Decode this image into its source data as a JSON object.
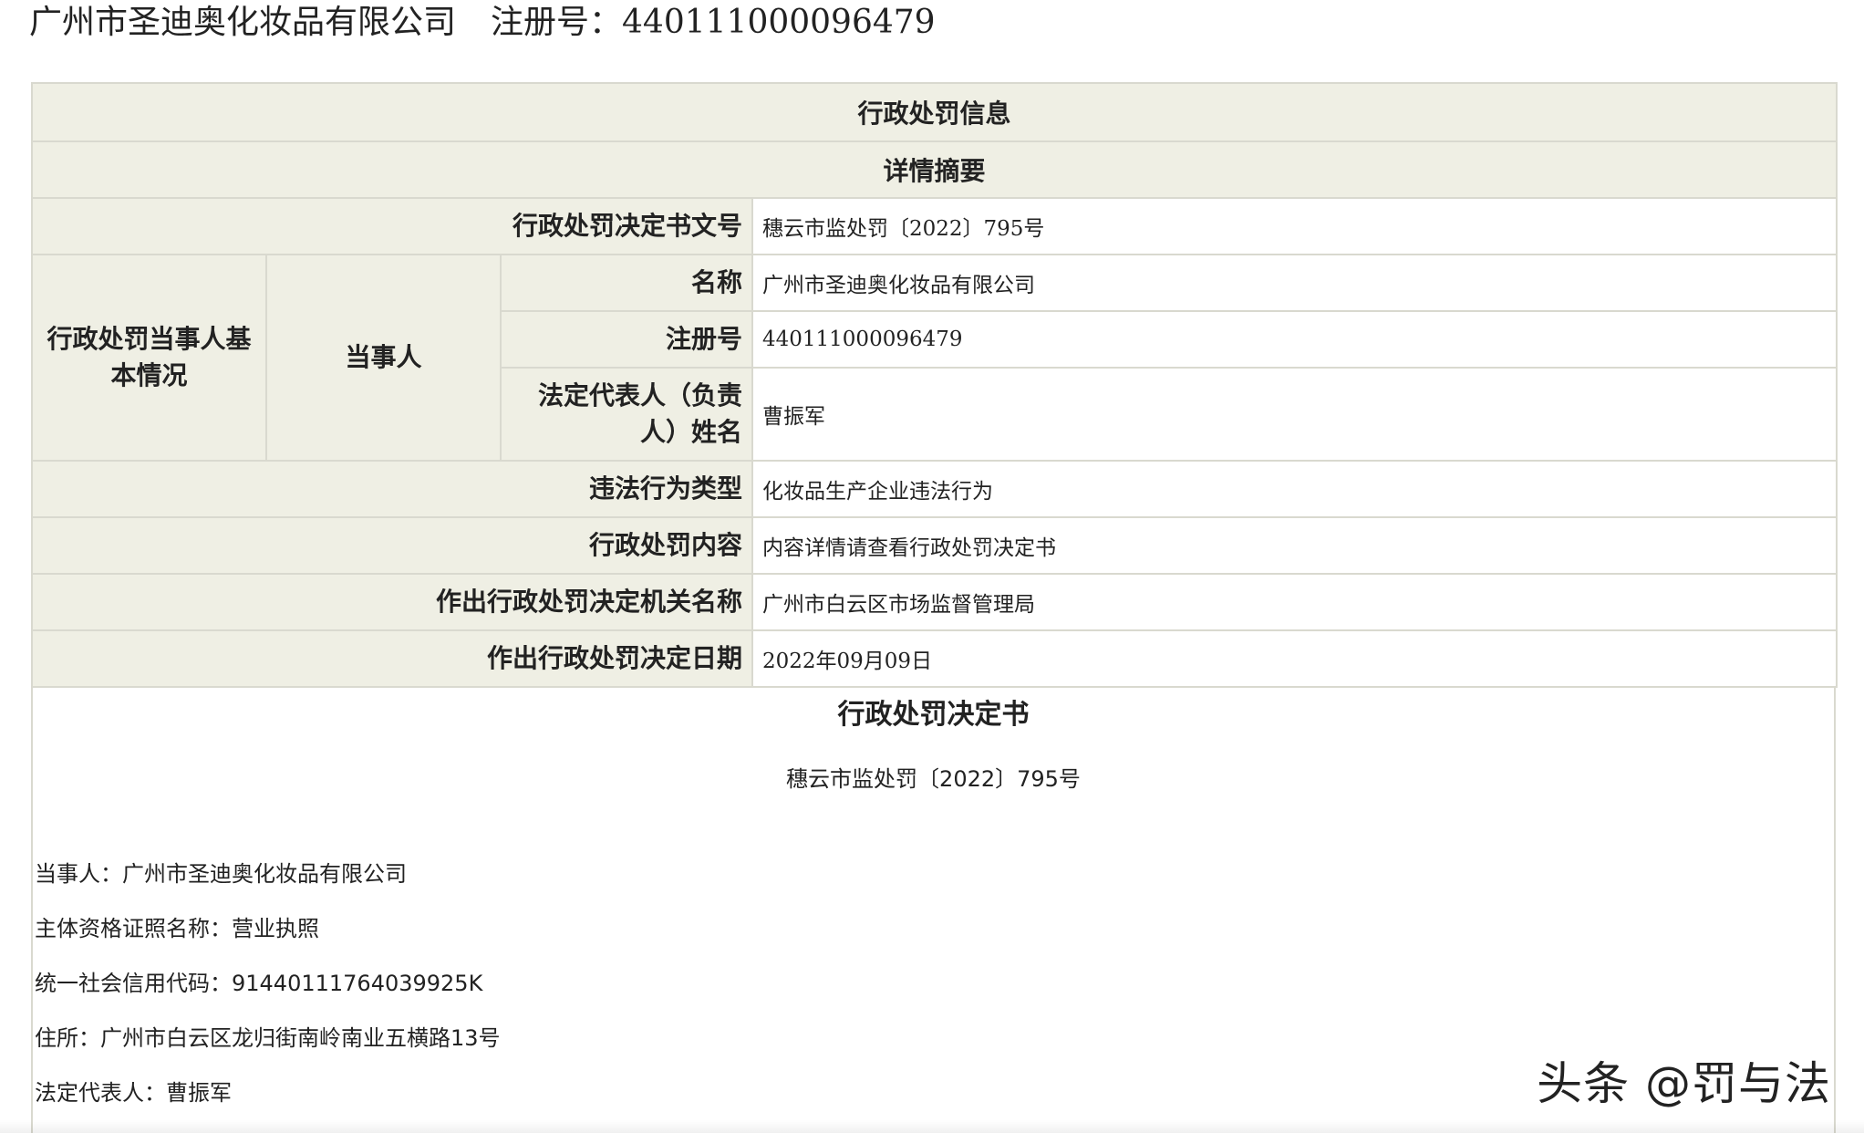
{
  "header": {
    "company_name": "广州市圣迪奥化妆品有限公司",
    "registration": "注册号：440111000096479"
  },
  "info_table": {
    "title": "行政处罚信息",
    "subtitle": "详情摘要",
    "decision_no_label": "行政处罚决定书文号",
    "decision_no_value": "穗云市监处罚〔2022〕795号",
    "party_basic_label": "行政处罚当事人基本情况",
    "party_label": "当事人",
    "name_label": "名称",
    "name_value": "广州市圣迪奥化妆品有限公司",
    "reg_label": "注册号",
    "reg_value": "440111000096479",
    "rep_label": "法定代表人（负责人）姓名",
    "rep_value": "曹振军",
    "violation_type_label": "违法行为类型",
    "violation_type_value": "化妆品生产企业违法行为",
    "content_label": "行政处罚内容",
    "content_value": "内容详情请查看行政处罚决定书",
    "authority_label": "作出行政处罚决定机关名称",
    "authority_value": "广州市白云区市场监督管理局",
    "date_label": "作出行政处罚决定日期",
    "date_value": "2022年09月09日"
  },
  "decision_doc": {
    "title": "行政处罚决定书",
    "number": "穗云市监处罚〔2022〕795号",
    "lines": [
      "当事人：广州市圣迪奥化妆品有限公司",
      "主体资格证照名称：营业执照",
      "统一社会信用代码：91440111764039925K",
      "住所：广州市白云区龙归街南岭南业五横路13号",
      "法定代表人：曹振军"
    ]
  },
  "watermark": "头条 @罚与法"
}
